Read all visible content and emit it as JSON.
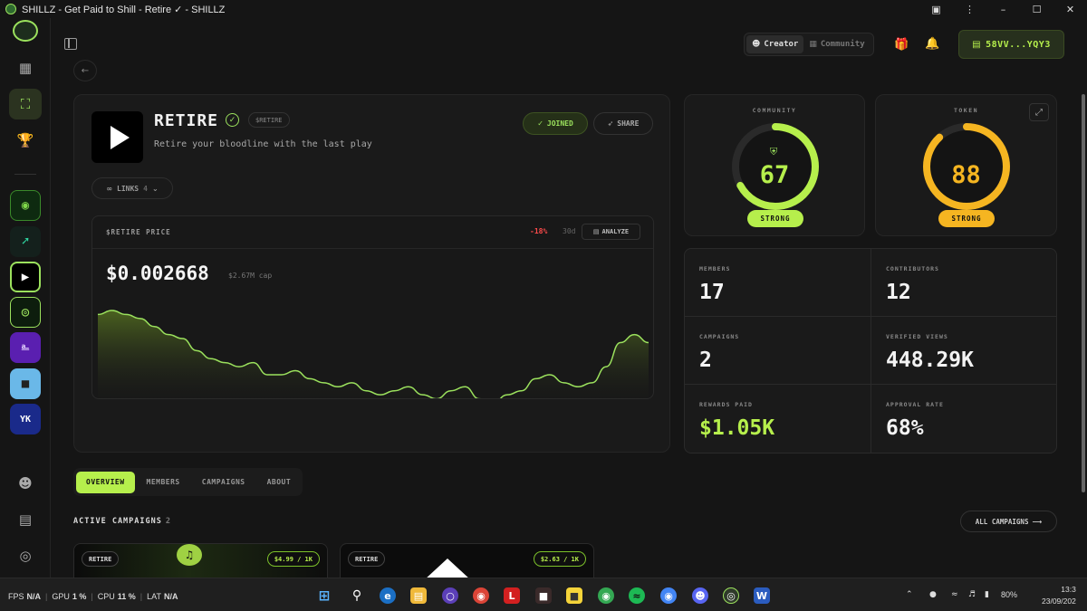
{
  "window": {
    "title": "SHILLZ - Get Paid to Shill - Retire ✓ - SHILLZ",
    "controls": [
      "–",
      "☐",
      "✕"
    ]
  },
  "header": {
    "mode_creator": "Creator",
    "mode_community": "Community",
    "wallet": "58VV...YQY3"
  },
  "project": {
    "name": "RETIRE",
    "ticker": "$RETIRE",
    "tagline": "Retire your bloodline with the last play",
    "joined_label": "JOINED",
    "share_label": "SHARE",
    "links_label": "LINKS",
    "links_count": "4"
  },
  "price": {
    "label": "$RETIRE PRICE",
    "change": "-18%",
    "period": "30d",
    "analyze_label": "ANALYZE",
    "value": "$0.002668",
    "cap": "$2.67M cap"
  },
  "chart_data": {
    "type": "area",
    "title": "",
    "xlabel": "",
    "ylabel": "",
    "values": [
      0.00283,
      0.00284,
      0.00283,
      0.00282,
      0.0028,
      0.00278,
      0.00277,
      0.00274,
      0.00272,
      0.00271,
      0.0027,
      0.00271,
      0.00268,
      0.00268,
      0.00269,
      0.00267,
      0.00266,
      0.00265,
      0.00266,
      0.00264,
      0.00263,
      0.00264,
      0.00265,
      0.00263,
      0.00262,
      0.00264,
      0.00265,
      0.00262,
      0.00261,
      0.00263,
      0.00264,
      0.00267,
      0.00268,
      0.00266,
      0.00265,
      0.00266,
      0.0027,
      0.00276,
      0.00278,
      0.00276
    ],
    "grid": false
  },
  "scores": {
    "community": {
      "label": "COMMUNITY",
      "value": 67,
      "status": "STRONG",
      "color": "#b6ef4c"
    },
    "token": {
      "label": "TOKEN",
      "value": 88,
      "status": "STRONG",
      "color": "#f5b521"
    }
  },
  "stats": [
    {
      "label": "MEMBERS",
      "value": "17"
    },
    {
      "label": "CONTRIBUTORS",
      "value": "12"
    },
    {
      "label": "CAMPAIGNS",
      "value": "2"
    },
    {
      "label": "VERIFIED VIEWS",
      "value": "448.29K"
    },
    {
      "label": "REWARDS PAID",
      "value": "$1.05K"
    },
    {
      "label": "APPROVAL RATE",
      "value": "68%"
    }
  ],
  "tabs": [
    "OVERVIEW",
    "MEMBERS",
    "CAMPAIGNS",
    "ABOUT"
  ],
  "campaigns": {
    "title": "ACTIVE CAMPAIGNS",
    "count": "2",
    "all_label": "ALL CAMPAIGNS",
    "items": [
      {
        "tag": "RETIRE",
        "rate": "$4.99 / 1K"
      },
      {
        "tag": "RETIRE",
        "rate": "$2.63 / 1K"
      }
    ]
  },
  "taskbar": {
    "fps_label": "FPS",
    "fps": "N/A",
    "gpu_label": "GPU",
    "gpu": "1 %",
    "cpu_label": "CPU",
    "cpu": "11 %",
    "lat_label": "LAT",
    "lat": "N/A",
    "battery": "80%",
    "time": "13:3",
    "date": "23/09/202"
  }
}
